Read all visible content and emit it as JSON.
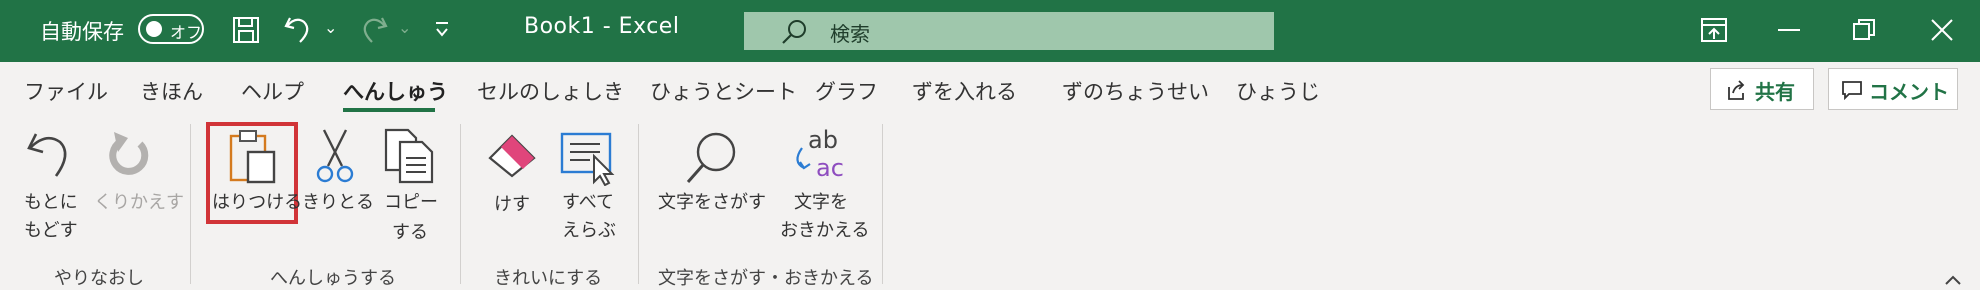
{
  "titlebar": {
    "autosave_label": "自動保存",
    "autosave_state": "オフ",
    "document_title": "Book1  -  Excel",
    "search_placeholder": "検索",
    "accent_color": "#217346"
  },
  "tabs": [
    {
      "label": "ファイル"
    },
    {
      "label": "きほん"
    },
    {
      "label": "ヘルプ"
    },
    {
      "label": "へんしゅう",
      "active": true
    },
    {
      "label": "セルのしょしき"
    },
    {
      "label": "ひょうとシート"
    },
    {
      "label": "グラフ"
    },
    {
      "label": "ずを入れる"
    },
    {
      "label": "ずのちょうせい"
    },
    {
      "label": "ひょうじ"
    }
  ],
  "header_buttons": {
    "share_label": "共有",
    "comment_label": "コメント"
  },
  "ribbon": {
    "undo": {
      "line1": "もとに",
      "line2": "もどす"
    },
    "redo": {
      "label": "くりかえす"
    },
    "paste": {
      "label": "はりつける"
    },
    "cut": {
      "label": "きりとる"
    },
    "copy": {
      "line1": "コピー",
      "line2": "する"
    },
    "clear": {
      "label": "けす"
    },
    "select_all": {
      "line1": "すべて",
      "line2": "えらぶ"
    },
    "find": {
      "label": "文字をさがす"
    },
    "replace": {
      "line1": "文字を",
      "line2": "おきかえる"
    },
    "groups": {
      "undo_group": "やりなおし",
      "edit_group": "へんしゅうする",
      "clean_group": "きれいにする",
      "find_group": "文字をさがす・おきかえる"
    }
  }
}
